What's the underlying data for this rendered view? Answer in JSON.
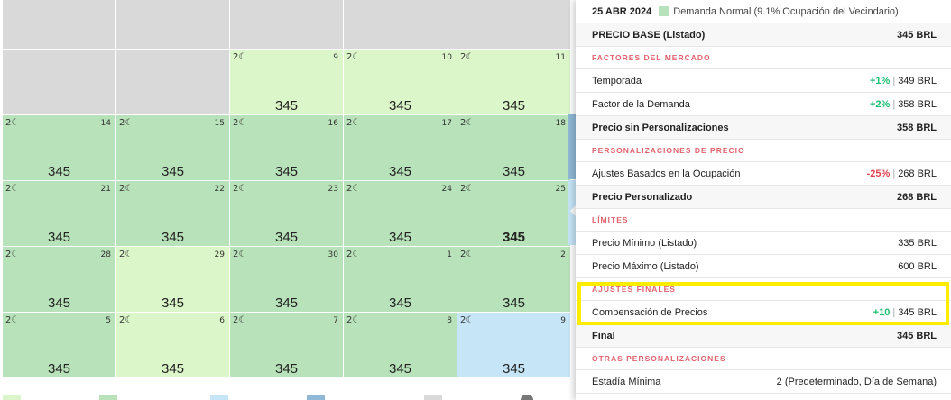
{
  "calendar": {
    "row0": [
      {
        "color": "gray"
      },
      {
        "color": "gray"
      },
      {
        "color": "gray"
      },
      {
        "color": "gray"
      },
      {
        "color": "gray"
      }
    ],
    "row1": [
      {
        "color": "gray",
        "day": "",
        "nights": "",
        "price": ""
      },
      {
        "color": "gray",
        "day": "",
        "nights": "",
        "price": ""
      },
      {
        "color": "lg",
        "day": "9",
        "nights": "2☾",
        "price": "345"
      },
      {
        "color": "lg",
        "day": "10",
        "nights": "2☾",
        "price": "345"
      },
      {
        "color": "lg",
        "day": "11",
        "nights": "2☾",
        "price": "345"
      }
    ],
    "row2": [
      {
        "color": "g",
        "day": "14",
        "nights": "2☾",
        "price": "345"
      },
      {
        "color": "g",
        "day": "15",
        "nights": "2☾",
        "price": "345"
      },
      {
        "color": "g",
        "day": "16",
        "nights": "2☾",
        "price": "345"
      },
      {
        "color": "g",
        "day": "17",
        "nights": "2☾",
        "price": "345"
      },
      {
        "color": "g",
        "day": "18",
        "nights": "2☾",
        "price": "345"
      }
    ],
    "row3": [
      {
        "color": "g",
        "day": "21",
        "nights": "2☾",
        "price": "345"
      },
      {
        "color": "g",
        "day": "22",
        "nights": "2☾",
        "price": "345"
      },
      {
        "color": "g",
        "day": "23",
        "nights": "2☾",
        "price": "345"
      },
      {
        "color": "g",
        "day": "24",
        "nights": "2☾",
        "price": "345"
      },
      {
        "color": "g",
        "day": "25",
        "nights": "2☾",
        "price": "345",
        "selected": true
      }
    ],
    "row4": [
      {
        "color": "g",
        "day": "28",
        "nights": "2☾",
        "price": "345"
      },
      {
        "color": "lg",
        "day": "29",
        "nights": "2☾",
        "price": "345"
      },
      {
        "color": "g",
        "day": "30",
        "nights": "2☾",
        "price": "345"
      },
      {
        "color": "g",
        "day": "1",
        "nights": "2☾",
        "price": "345"
      },
      {
        "color": "g",
        "day": "2",
        "nights": "2☾",
        "price": "345"
      }
    ],
    "row5": [
      {
        "color": "g",
        "day": "5",
        "nights": "2☾",
        "price": "345"
      },
      {
        "color": "lg",
        "day": "6",
        "nights": "2☾",
        "price": "345"
      },
      {
        "color": "g",
        "day": "7",
        "nights": "2☾",
        "price": "345"
      },
      {
        "color": "g",
        "day": "8",
        "nights": "2☾",
        "price": "345"
      },
      {
        "color": "b",
        "day": "9",
        "nights": "2☾",
        "price": "345"
      }
    ]
  },
  "colors": {
    "light_green": "#dbf6c9",
    "green": "#b8e2b9",
    "blue": "#c6e6f7",
    "gray": "#d9d9d9",
    "section_red": "#e0626d",
    "positive": "#1dbf73",
    "negative": "#e0434f",
    "highlight": "#ffec00"
  },
  "panel": {
    "date": "25 ABR 2024",
    "demand": "Demanda Normal (9.1% Ocupación del Vecindario)",
    "base_label": "PRECIO BASE (Listado)",
    "base_value": "345 BRL",
    "market_title": "FACTORES DEL MERCADO",
    "season_label": "Temporada",
    "season_pct": "+1%",
    "season_value": "349 BRL",
    "demand_factor_label": "Factor de la Demanda",
    "demand_factor_pct": "+2%",
    "demand_factor_value": "358 BRL",
    "no_custom_label": "Precio sin Personalizaciones",
    "no_custom_value": "358 BRL",
    "custom_title": "PERSONALIZACIONES DE PRECIO",
    "occupancy_label": "Ajustes Basados en la Ocupación",
    "occupancy_pct": "-25%",
    "occupancy_value": "268 BRL",
    "custom_price_label": "Precio Personalizado",
    "custom_price_value": "268 BRL",
    "limits_title": "LÍMITES",
    "min_label": "Precio Mínimo (Listado)",
    "min_value": "335 BRL",
    "max_label": "Precio Máximo (Listado)",
    "max_value": "600 BRL",
    "final_adj_title": "AJUSTES FINALES",
    "comp_label": "Compensación de Precios",
    "comp_pct": "+10",
    "comp_value": "345 BRL",
    "final_label": "Final",
    "final_value": "345 BRL",
    "other_title": "OTRAS PERSONALIZACIONES",
    "min_stay_label": "Estadía Mínima",
    "min_stay_value": "2 (Predeterminado, Día de Semana)",
    "separator": "|"
  }
}
